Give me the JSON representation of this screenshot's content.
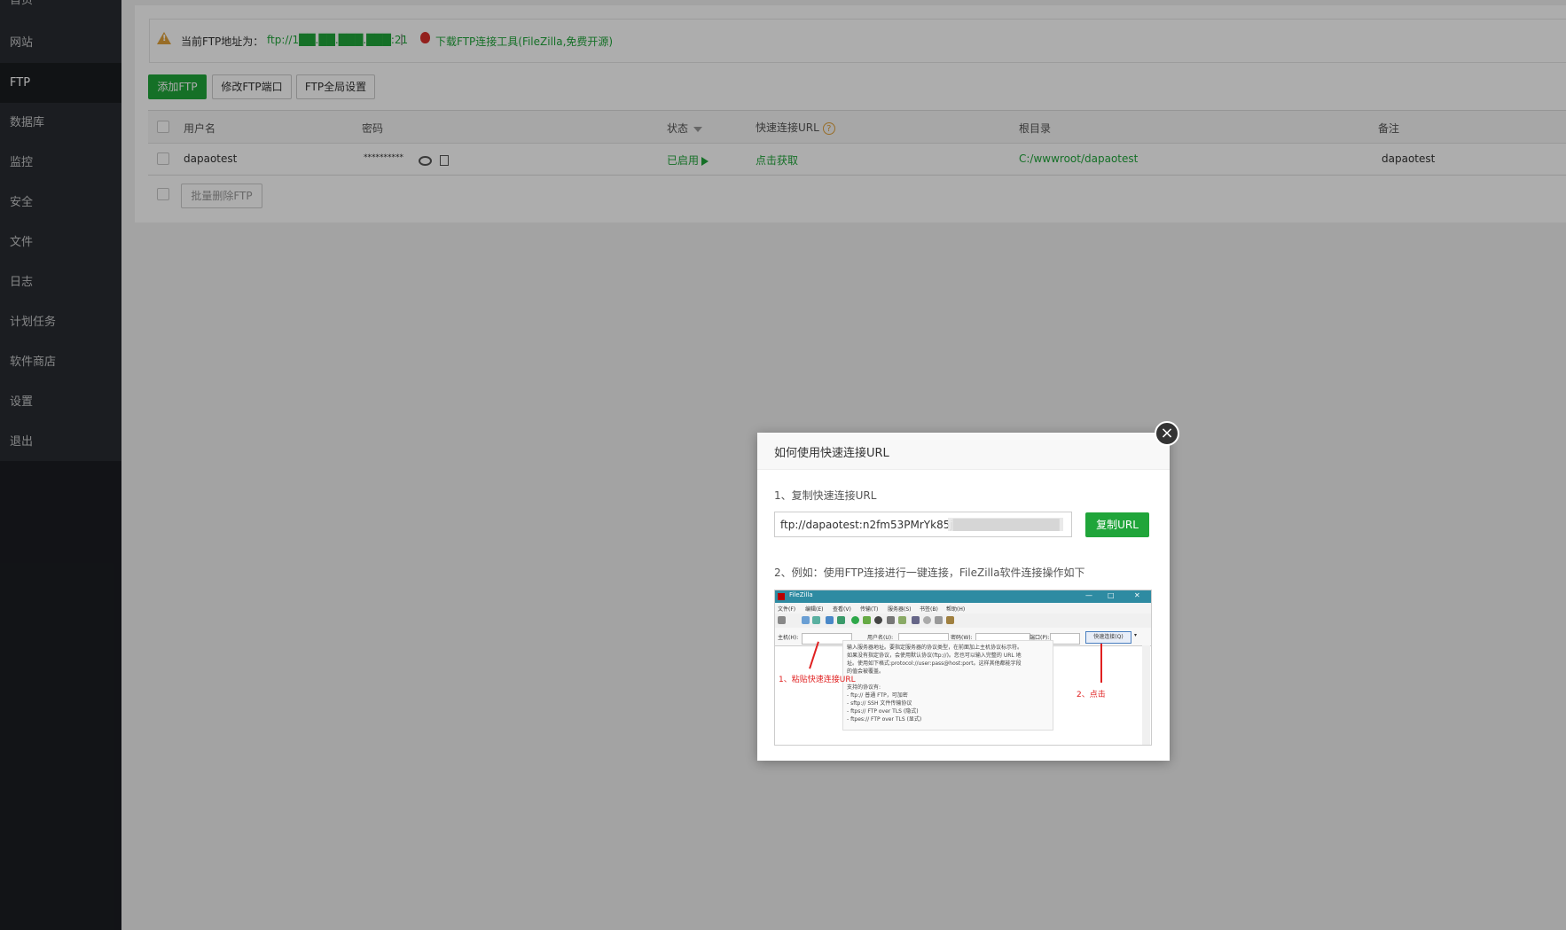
{
  "sidebar": {
    "items": [
      {
        "label": "首页",
        "active": false
      },
      {
        "label": "网站",
        "active": false
      },
      {
        "label": "FTP",
        "active": true
      },
      {
        "label": "数据库",
        "active": false
      },
      {
        "label": "监控",
        "active": false
      },
      {
        "label": "安全",
        "active": false
      },
      {
        "label": "文件",
        "active": false
      },
      {
        "label": "日志",
        "active": false
      },
      {
        "label": "计划任务",
        "active": false
      },
      {
        "label": "软件商店",
        "active": false
      },
      {
        "label": "设置",
        "active": false
      },
      {
        "label": "退出",
        "active": false
      }
    ]
  },
  "notice": {
    "label": "当前FTP地址为：",
    "address": "ftp://1██.██.███.███:21",
    "separator": "|",
    "download_link": "下载FTP连接工具(FileZilla,免费开源)"
  },
  "toolbar": {
    "add_ftp": "添加FTP",
    "change_port": "修改FTP端口",
    "global_settings": "FTP全局设置"
  },
  "table": {
    "headers": {
      "username": "用户名",
      "password": "密码",
      "status": "状态",
      "quick_url": "快速连接URL",
      "quick_url_help": "?",
      "root": "根目录",
      "note": "备注"
    },
    "rows": [
      {
        "username": "dapaotest",
        "password": "**********",
        "status": "已启用",
        "quick_url": "点击获取",
        "root": "C:/wwwroot/dapaotest",
        "note": "dapaotest"
      }
    ],
    "batch_delete": "批量删除FTP"
  },
  "modal": {
    "title": "如何使用快速连接URL",
    "close": "×",
    "step1": "1、复制快速连接URL",
    "url_value": "ftp://dapaotest:n2fm53PMrYk85j█████████████",
    "copy_button": "复制URL",
    "step2": "2、例如：使用FTP连接进行一键连接，FileZilla软件连接操作如下",
    "filezilla": {
      "window_title": "FileZilla",
      "menu": [
        "文件(F)",
        "编辑(E)",
        "查看(V)",
        "传输(T)",
        "服务器(S)",
        "书签(B)",
        "帮助(H)"
      ],
      "host_label": "主机(H):",
      "user_label": "用户名(U):",
      "pass_label": "密码(W):",
      "port_label": "端口(P):",
      "quick_button": "快速连接(Q)",
      "tip_lines": [
        "输入服务器地址。要指定服务器的协议类型，在前面加上主机协议标示符。",
        "如果没有指定协议，会使用默认协议(ftp://)。您也可以输入完整的 URL 地",
        "址。使用如下格式:protocol://user:pass@host:port。这样其他都能字段",
        "的值会被覆盖。",
        "",
        "支持的协议有:",
        "- ftp:// 普通 FTP，可加密",
        "- sftp:// SSH 文件传输协议",
        "- ftps:// FTP over TLS (隐式)",
        "- ftpes:// FTP over TLS (显式)"
      ],
      "annot_paste": "1、粘贴快速连接URL",
      "annot_click": "2、点击"
    }
  },
  "colors": {
    "accent": "#20a53a",
    "sidebar_bg": "#292c31",
    "sidebar_active": "#1a1c20",
    "warning": "#e0a13a",
    "annotation": "#e02020"
  }
}
